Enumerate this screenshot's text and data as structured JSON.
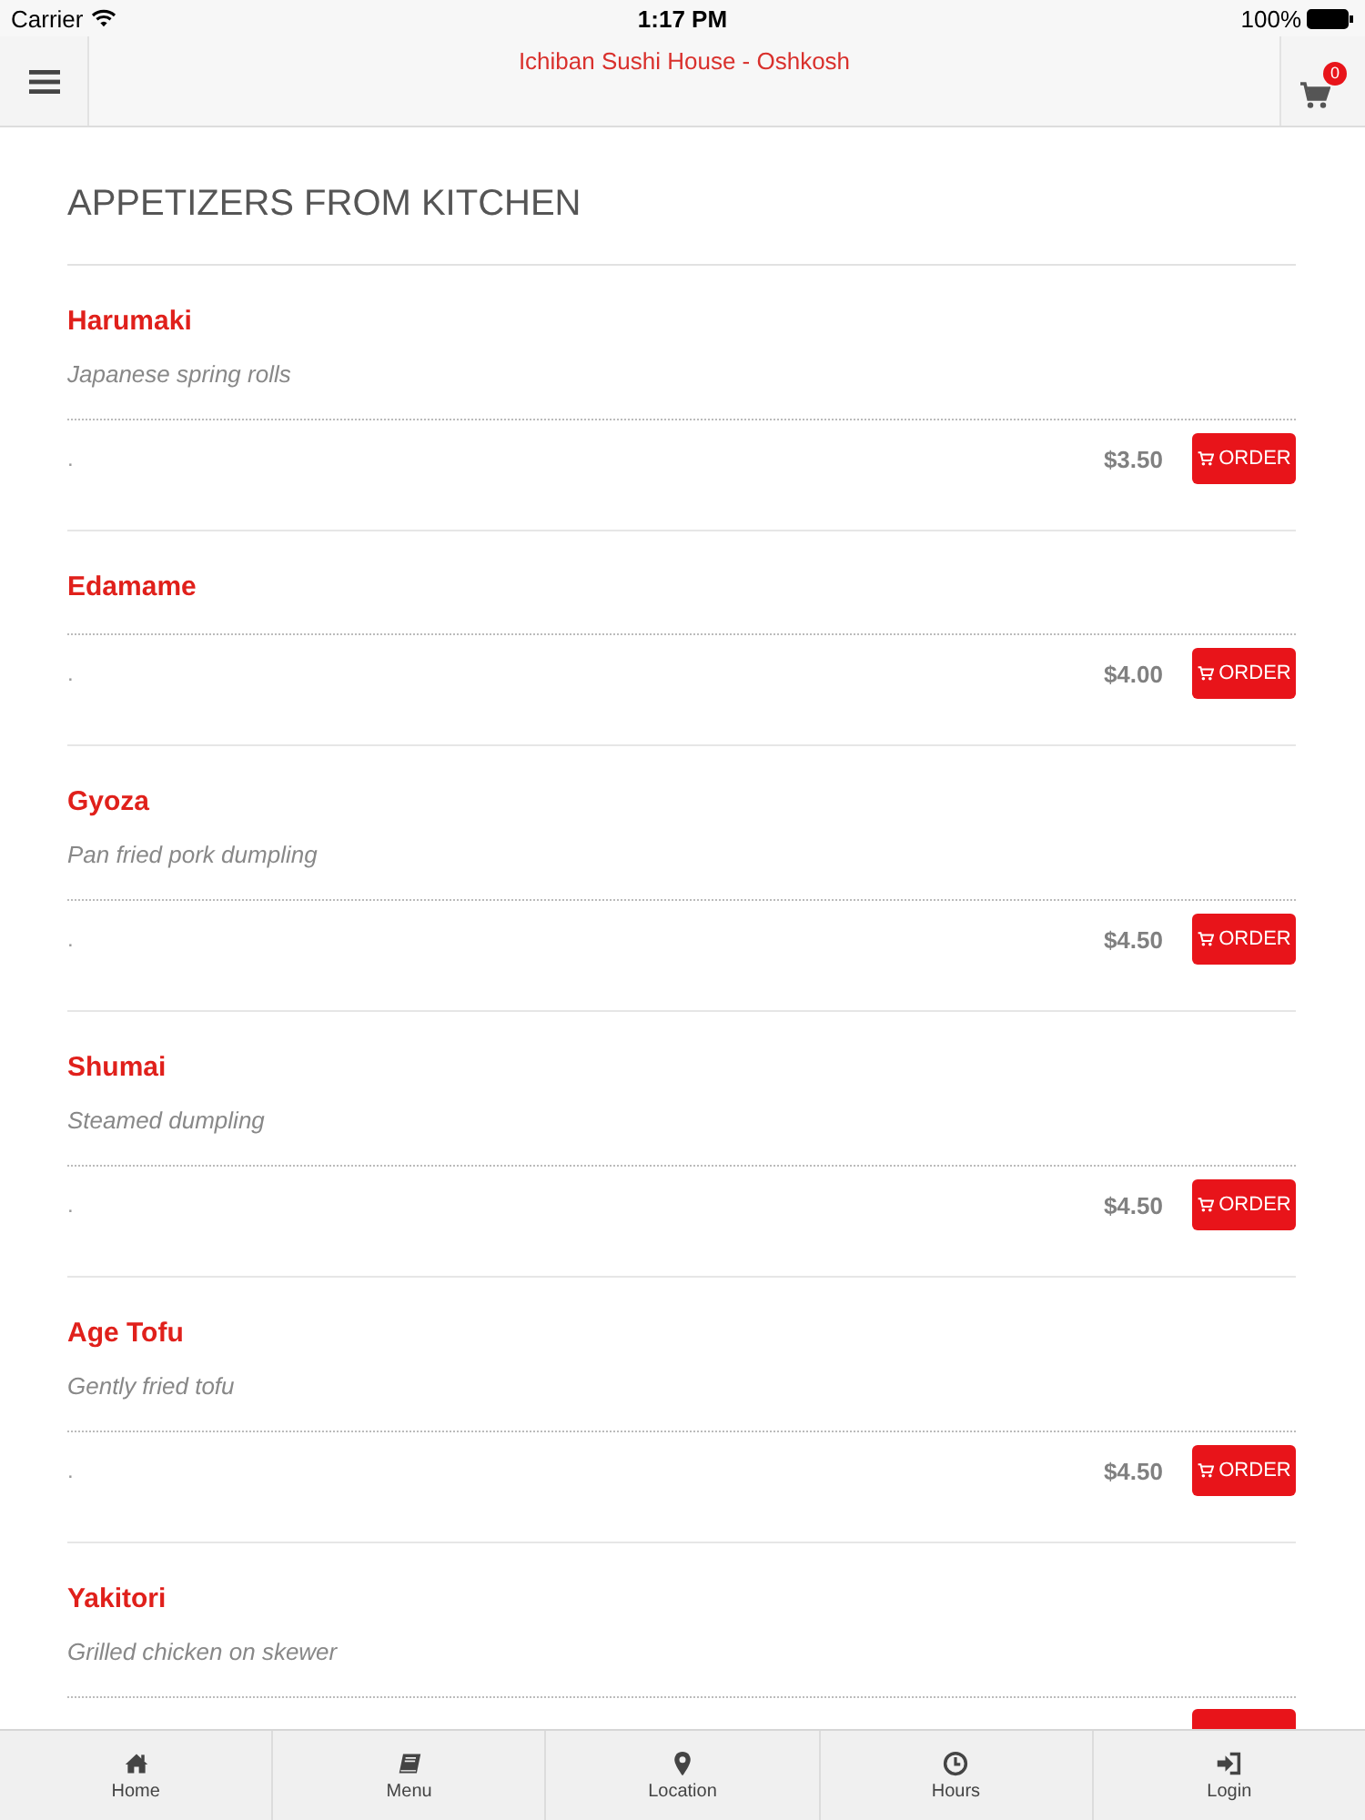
{
  "status_bar": {
    "carrier": "Carrier",
    "time": "1:17 PM",
    "battery": "100%"
  },
  "nav_bar": {
    "title": "Ichiban Sushi House - Oshkosh",
    "cart_count": "0"
  },
  "section": {
    "heading": "APPETIZERS FROM KITCHEN",
    "items": [
      {
        "kind": "full",
        "name": "Harumaki",
        "description": "Japanese spring rolls",
        "note": ".",
        "price": "$3.50",
        "button": "ORDER"
      },
      {
        "kind": "full",
        "name": "Edamame",
        "note": ".",
        "price": "$4.00",
        "button": "ORDER"
      },
      {
        "kind": "full",
        "name": "Gyoza",
        "description": "Pan fried pork dumpling",
        "note": ".",
        "price": "$4.50",
        "button": "ORDER"
      },
      {
        "kind": "full",
        "name": "Shumai",
        "description": "Steamed dumpling",
        "note": ".",
        "price": "$4.50",
        "button": "ORDER"
      },
      {
        "kind": "full",
        "name": "Age Tofu",
        "description": "Gently fried tofu",
        "note": ".",
        "price": "$4.50",
        "button": "ORDER"
      },
      {
        "kind": "clipped",
        "name": "Yakitori",
        "description": "Grilled chicken on skewer"
      }
    ]
  },
  "tab_bar": {
    "tabs": [
      {
        "label": "Home"
      },
      {
        "label": "Menu"
      },
      {
        "label": "Location"
      },
      {
        "label": "Hours"
      },
      {
        "label": "Login"
      }
    ]
  }
}
